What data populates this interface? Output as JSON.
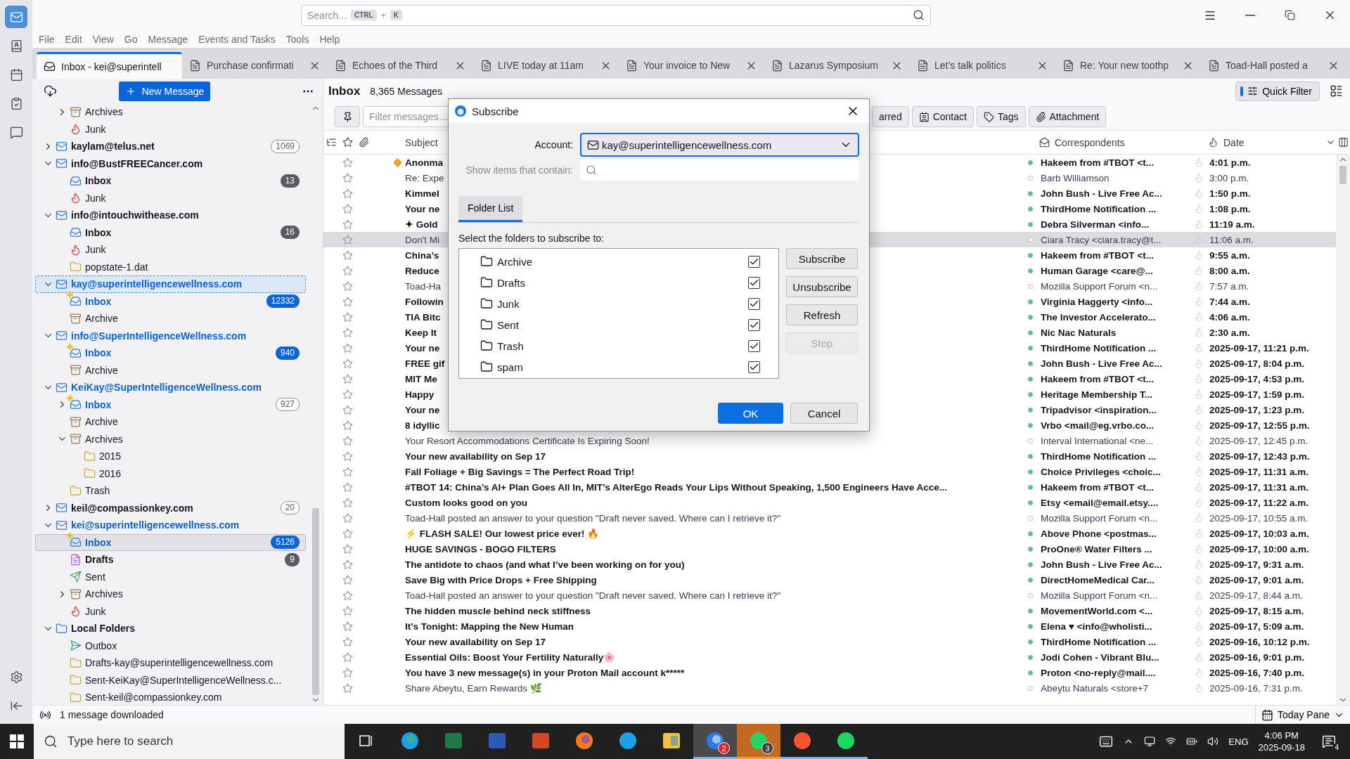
{
  "spaces": [
    {
      "kind": "mail",
      "selected": true
    },
    {
      "kind": "contacts",
      "selected": false
    },
    {
      "kind": "calendar",
      "selected": false
    },
    {
      "kind": "tasks",
      "selected": false
    },
    {
      "kind": "chat",
      "selected": false
    }
  ],
  "search": {
    "placeholder": "Search...",
    "shortcut": [
      "CTRL",
      "+",
      "K"
    ]
  },
  "menu": [
    "File",
    "Edit",
    "View",
    "Go",
    "Message",
    "Events and Tasks",
    "Tools",
    "Help"
  ],
  "tabs": [
    {
      "kind": "folder",
      "label": "Inbox - kei@superintell",
      "selected": true
    },
    {
      "kind": "message",
      "label": "Purchase confirmati",
      "selected": false
    },
    {
      "kind": "message",
      "label": "Echoes of the Third",
      "selected": false
    },
    {
      "kind": "message",
      "label": "LIVE today at 11am",
      "selected": false
    },
    {
      "kind": "message",
      "label": "Your invoice to New",
      "selected": false
    },
    {
      "kind": "message",
      "label": "Lazarus Symposium",
      "selected": false
    },
    {
      "kind": "message",
      "label": "Let’s talk politics",
      "selected": false
    },
    {
      "kind": "message",
      "label": "Re: Your new toothp",
      "selected": false
    },
    {
      "kind": "message",
      "label": "Toad-Hall posted a",
      "selected": false
    }
  ],
  "folder_pane": {
    "new_message": "New Message",
    "tree": [
      {
        "children": [
          {
            "label": "Archives",
            "kind": "archive",
            "expanded": false,
            "unread": false,
            "new": false,
            "selected": false,
            "focused": false
          },
          {
            "label": "Junk",
            "kind": "junk",
            "unread": false,
            "new": false,
            "selected": false,
            "focused": false
          }
        ]
      },
      {
        "label": "kaylam@telus.net",
        "kind": "account",
        "expanded": false,
        "count": "1069",
        "count_outlined": true,
        "unread": true,
        "new": false,
        "selected": false,
        "focused": false
      },
      {
        "label": "info@BustFREECancer.com",
        "kind": "account",
        "expanded": true,
        "unread": true,
        "new": false,
        "selected": false,
        "focused": false,
        "children": [
          {
            "label": "Inbox",
            "kind": "inbox",
            "count": "13",
            "count_outlined": false,
            "unread": true,
            "new": false,
            "selected": false,
            "focused": false
          },
          {
            "label": "Junk",
            "kind": "junk",
            "unread": false,
            "new": false,
            "selected": false,
            "focused": false
          }
        ]
      },
      {
        "label": "info@intouchwithease.com",
        "kind": "account",
        "expanded": true,
        "unread": true,
        "new": false,
        "selected": false,
        "focused": false,
        "children": [
          {
            "label": "Inbox",
            "kind": "inbox",
            "count": "16",
            "count_outlined": false,
            "unread": true,
            "new": false,
            "selected": false,
            "focused": false
          },
          {
            "label": "Junk",
            "kind": "junk",
            "unread": false,
            "new": false,
            "selected": false,
            "focused": false
          },
          {
            "label": "popstate-1.dat",
            "kind": "folder",
            "unread": false,
            "new": false,
            "selected": false,
            "focused": false
          }
        ]
      },
      {
        "label": "kay@superintelligencewellness.com",
        "kind": "account",
        "expanded": true,
        "unread": true,
        "new": true,
        "selected": false,
        "focused": true,
        "children": [
          {
            "label": "Inbox",
            "kind": "inbox",
            "count": "12332",
            "count_outlined": false,
            "unread": true,
            "new": true,
            "selected": false,
            "focused": false
          },
          {
            "label": "Archive",
            "kind": "archive",
            "unread": false,
            "new": false,
            "selected": false,
            "focused": false
          }
        ]
      },
      {
        "label": "info@SuperIntelligenceWellness.com",
        "kind": "account",
        "expanded": true,
        "unread": true,
        "new": true,
        "selected": false,
        "focused": false,
        "children": [
          {
            "label": "Inbox",
            "kind": "inbox",
            "count": "940",
            "count_outlined": false,
            "unread": true,
            "new": true,
            "selected": false,
            "focused": false
          },
          {
            "label": "Archive",
            "kind": "archive",
            "unread": false,
            "new": false,
            "selected": false,
            "focused": false
          }
        ]
      },
      {
        "label": "KeiKay@SuperIntelligenceWellness.com",
        "kind": "account",
        "expanded": true,
        "unread": true,
        "new": true,
        "selected": false,
        "focused": false,
        "children": [
          {
            "label": "Inbox",
            "kind": "inbox",
            "expanded": false,
            "count": "927",
            "count_outlined": true,
            "unread": true,
            "new": true,
            "selected": false,
            "focused": false
          },
          {
            "label": "Archive",
            "kind": "archive",
            "unread": false,
            "new": false,
            "selected": false,
            "focused": false
          },
          {
            "label": "Archives",
            "kind": "archive",
            "expanded": true,
            "unread": false,
            "new": false,
            "selected": false,
            "focused": false,
            "children": [
              {
                "label": "2015",
                "kind": "folder",
                "unread": false,
                "new": false,
                "selected": false,
                "focused": false
              },
              {
                "label": "2016",
                "kind": "folder",
                "unread": false,
                "new": false,
                "selected": false,
                "focused": false
              }
            ]
          },
          {
            "label": "Trash",
            "kind": "folder",
            "unread": false,
            "new": false,
            "selected": false,
            "focused": false
          }
        ]
      },
      {
        "label": "keil@compassionkey.com",
        "kind": "account",
        "expanded": false,
        "count": "20",
        "count_outlined": true,
        "unread": true,
        "new": false,
        "selected": false,
        "focused": false
      },
      {
        "label": "kei@superintelligencewellness.com",
        "kind": "account",
        "expanded": true,
        "unread": true,
        "new": true,
        "selected": false,
        "focused": false,
        "children": [
          {
            "label": "Inbox",
            "kind": "inbox",
            "count": "5126",
            "count_outlined": false,
            "unread": true,
            "new": true,
            "selected": true,
            "focused": false
          },
          {
            "label": "Drafts",
            "kind": "drafts",
            "count": "9",
            "count_outlined": false,
            "unread": true,
            "new": false,
            "selected": false,
            "focused": false
          },
          {
            "label": "Sent",
            "kind": "sent",
            "unread": false,
            "new": false,
            "selected": false,
            "focused": false
          },
          {
            "label": "Archives",
            "kind": "archive",
            "expanded": false,
            "unread": false,
            "new": false,
            "selected": false,
            "focused": false
          },
          {
            "label": "Junk",
            "kind": "junk",
            "unread": false,
            "new": false,
            "selected": false,
            "focused": false
          }
        ]
      },
      {
        "label": "Local Folders",
        "kind": "local",
        "expanded": true,
        "unread": true,
        "new": false,
        "selected": false,
        "focused": false,
        "children": [
          {
            "label": "Outbox",
            "kind": "outbox",
            "unread": false,
            "new": false,
            "selected": false,
            "focused": false
          },
          {
            "label": "Drafts-kay@superintelligencewellness.com",
            "kind": "folder",
            "unread": false,
            "new": false,
            "selected": false,
            "focused": false
          },
          {
            "label": "Sent-KeiKay@SuperIntelligenceWellness.c...",
            "kind": "folder",
            "unread": false,
            "new": false,
            "selected": false,
            "focused": false
          },
          {
            "label": "Sent-keil@compassionkey.com",
            "kind": "folder",
            "unread": false,
            "new": false,
            "selected": false,
            "focused": false
          }
        ]
      }
    ]
  },
  "thread_pane": {
    "folder": "Inbox",
    "count": "8,365 Messages",
    "quick_filter": {
      "label": "Quick Filter",
      "on": true
    },
    "filter": {
      "placeholder": "Filter messages…",
      "buttons": [
        {
          "kind": "starred",
          "label": "arred"
        },
        {
          "kind": "contact",
          "label": "Contact"
        },
        {
          "kind": "tags",
          "label": "Tags"
        },
        {
          "kind": "attachment",
          "label": "Attachment"
        }
      ]
    },
    "columns": {
      "subject": "Subject",
      "correspondents": "Correspondents",
      "date": "Date"
    },
    "rows": [
      {
        "subject": "Anonma",
        "correspondent": "Hakeem from #TBOT <t...",
        "date": "4:01 p.m.",
        "unread": true,
        "new": true,
        "selected": false
      },
      {
        "subject": "Re: Expe",
        "correspondent": "Barb Williamson",
        "date": "3:00 p.m.",
        "unread": false,
        "new": false,
        "selected": false
      },
      {
        "subject": "Kimmel",
        "correspondent": "John Bush - Live Free Ac...",
        "date": "1:50 p.m.",
        "unread": true,
        "new": false,
        "selected": false
      },
      {
        "subject": "Your ne",
        "correspondent": "ThirdHome Notification ...",
        "date": "1:08 p.m.",
        "unread": true,
        "new": false,
        "selected": false
      },
      {
        "subject": "✦ Gold",
        "correspondent": "Debra Silverman <info...",
        "date": "11:19 a.m.",
        "unread": true,
        "new": false,
        "selected": false
      },
      {
        "subject": "Don't Mi",
        "correspondent": "Ciara Tracy <ciara.tracy@t...",
        "date": "11:06 a.m.",
        "unread": false,
        "new": false,
        "selected": true
      },
      {
        "subject": "China’s",
        "correspondent": "Hakeem from #TBOT <t...",
        "date": "9:55 a.m.",
        "unread": true,
        "new": false,
        "selected": false
      },
      {
        "subject": "Reduce",
        "correspondent": "Human Garage <care@...",
        "date": "8:00 a.m.",
        "unread": true,
        "new": false,
        "selected": false
      },
      {
        "subject": "Toad-Ha",
        "correspondent": "Mozilla Support Forum <n...",
        "date": "7:57 a.m.",
        "unread": false,
        "new": false,
        "selected": false
      },
      {
        "subject": "Followin",
        "correspondent": "Virginia Haggerty <info...",
        "date": "7:44 a.m.",
        "unread": true,
        "new": false,
        "selected": false
      },
      {
        "subject": "TIA Bitc",
        "correspondent": "The Investor Accelerato...",
        "date": "4:06 a.m.",
        "unread": true,
        "new": false,
        "selected": false
      },
      {
        "subject": "Keep It",
        "correspondent": "Nic Nac Naturals",
        "date": "2:30 a.m.",
        "unread": true,
        "new": false,
        "selected": false
      },
      {
        "subject": "Your ne",
        "correspondent": "ThirdHome Notification ...",
        "date": "2025-09-17, 11:21 p.m.",
        "unread": true,
        "new": false,
        "selected": false
      },
      {
        "subject": "FREE gif",
        "correspondent": "John Bush - Live Free Ac...",
        "date": "2025-09-17, 8:04 p.m.",
        "unread": true,
        "new": false,
        "selected": false
      },
      {
        "subject": "MIT Me",
        "correspondent": "Hakeem from #TBOT <t...",
        "date": "2025-09-17, 4:53 p.m.",
        "unread": true,
        "new": false,
        "selected": false
      },
      {
        "subject": "Happy",
        "correspondent": "Heritage Membership T...",
        "date": "2025-09-17, 1:59 p.m.",
        "unread": true,
        "new": false,
        "selected": false
      },
      {
        "subject": "Your ne",
        "correspondent": "Tripadvisor <inspiration...",
        "date": "2025-09-17, 1:23 p.m.",
        "unread": true,
        "new": false,
        "selected": false
      },
      {
        "subject": "8 idyllic",
        "correspondent": "Vrbo <mail@eg.vrbo.co...",
        "date": "2025-09-17, 12:55 p.m.",
        "unread": true,
        "new": false,
        "selected": false
      },
      {
        "subject": "Your Resort Accommodations Certificate Is Expiring Soon!",
        "correspondent": "Interval International <ne...",
        "date": "2025-09-17, 12:45 p.m.",
        "unread": false,
        "new": false,
        "selected": false
      },
      {
        "subject": "Your new availability on Sep 17",
        "correspondent": "ThirdHome Notification ...",
        "date": "2025-09-17, 12:43 p.m.",
        "unread": true,
        "new": false,
        "selected": false
      },
      {
        "subject": "Fall Foliage + Big Savings = The Perfect Road Trip!",
        "correspondent": "Choice Privileges <choic...",
        "date": "2025-09-17, 11:31 a.m.",
        "unread": true,
        "new": false,
        "selected": false
      },
      {
        "subject": "#TBOT 14: China’s AI+ Plan Goes All In, MIT’s AlterEgo Reads Your Lips Without Speaking, 1,500 Engineers Have Acce...",
        "correspondent": "Hakeem from #TBOT <t...",
        "date": "2025-09-17, 11:31 a.m.",
        "unread": true,
        "new": false,
        "selected": false
      },
      {
        "subject": "Custom looks good on you",
        "correspondent": "Etsy <email@email.etsy....",
        "date": "2025-09-17, 11:22 a.m.",
        "unread": true,
        "new": false,
        "selected": false
      },
      {
        "subject": "Toad-Hall posted an answer to your question \"Draft never saved. Where can I retrieve it?\"",
        "correspondent": "Mozilla Support Forum <n...",
        "date": "2025-09-17, 10:55 a.m.",
        "unread": false,
        "new": false,
        "selected": false
      },
      {
        "subject": "⚡ FLASH SALE! Our lowest price ever! 🔥",
        "correspondent": "Above Phone <postmas...",
        "date": "2025-09-17, 10:03 a.m.",
        "unread": true,
        "new": false,
        "selected": false
      },
      {
        "subject": "HUGE SAVINGS - BOGO FILTERS",
        "correspondent": "ProOne® Water Filters ...",
        "date": "2025-09-17, 10:00 a.m.",
        "unread": true,
        "new": false,
        "selected": false
      },
      {
        "subject": "The antidote to chaos (and what I’ve been working on for you)",
        "correspondent": "John Bush - Live Free Ac...",
        "date": "2025-09-17, 9:31 a.m.",
        "unread": true,
        "new": false,
        "selected": false
      },
      {
        "subject": "Save Big with Price Drops + Free Shipping",
        "correspondent": "DirectHomeMedical Car...",
        "date": "2025-09-17, 9:01 a.m.",
        "unread": true,
        "new": false,
        "selected": false
      },
      {
        "subject": "Toad-Hall posted an answer to your question \"Draft never saved. Where can I retrieve it?\"",
        "correspondent": "Mozilla Support Forum <n...",
        "date": "2025-09-17, 8:44 a.m.",
        "unread": false,
        "new": false,
        "selected": false
      },
      {
        "subject": "The hidden muscle behind neck stiffness",
        "correspondent": "MovementWorld.com <...",
        "date": "2025-09-17, 8:15 a.m.",
        "unread": true,
        "new": false,
        "selected": false
      },
      {
        "subject": "It’s Tonight: Mapping the New Human",
        "correspondent": "Elena ♥ <info@wholisti...",
        "date": "2025-09-17, 5:09 a.m.",
        "unread": true,
        "new": false,
        "selected": false
      },
      {
        "subject": "Your new availability on Sep 17",
        "correspondent": "ThirdHome Notification ...",
        "date": "2025-09-16, 10:12 p.m.",
        "unread": true,
        "new": false,
        "selected": false
      },
      {
        "subject": "Essential Oils: Boost Your Fertility Naturally🌸",
        "correspondent": "Jodi Cohen - Vibrant Blu...",
        "date": "2025-09-16, 9:01 p.m.",
        "unread": true,
        "new": false,
        "selected": false
      },
      {
        "subject": "You have 3 new message(s) in your Proton Mail account k*****",
        "correspondent": "Proton <no-reply@mail....",
        "date": "2025-09-16, 7:40 p.m.",
        "unread": true,
        "new": false,
        "selected": false
      },
      {
        "subject": "Share Abeytu, Earn Rewards 🌿",
        "correspondent": "Abeytu Naturals <store+7",
        "date": "2025-09-16, 7:31 p.m.",
        "unread": false,
        "new": false,
        "selected": false
      }
    ]
  },
  "dialog": {
    "title": "Subscribe",
    "account_label": "Account:",
    "account": "kay@superintelligencewellness.com",
    "filter_label": "Show items that contain:",
    "tabs": [
      {
        "label": "Folder List",
        "selected": true
      }
    ],
    "list_label": "Select the folders to subscribe to:",
    "folders": [
      {
        "label": "Archive",
        "checked": true
      },
      {
        "label": "Drafts",
        "checked": true
      },
      {
        "label": "Junk",
        "checked": true
      },
      {
        "label": "Sent",
        "checked": true
      },
      {
        "label": "Trash",
        "checked": true
      },
      {
        "label": "spam",
        "checked": true
      }
    ],
    "actions": [
      {
        "label": "Subscribe",
        "disabled": false
      },
      {
        "label": "Unsubscribe",
        "disabled": false
      },
      {
        "label": "Refresh",
        "disabled": false
      },
      {
        "label": "Stop",
        "disabled": true
      }
    ],
    "buttons": [
      {
        "label": "OK",
        "kind": "primary"
      },
      {
        "label": "Cancel",
        "kind": "secondary"
      }
    ]
  },
  "status_bar": {
    "text": "1 message downloaded",
    "today_pane": "Today Pane"
  },
  "taskbar": {
    "search_placeholder": "Type here to search",
    "apps": [
      {
        "kind": "taskview",
        "running": false,
        "active": false,
        "flashing": false
      },
      {
        "kind": "edge",
        "running": false,
        "active": false,
        "flashing": false
      },
      {
        "kind": "excel",
        "running": false,
        "active": false,
        "flashing": false
      },
      {
        "kind": "word",
        "running": false,
        "active": false,
        "flashing": false
      },
      {
        "kind": "powerpoint",
        "running": false,
        "active": false,
        "flashing": false
      },
      {
        "kind": "firefox",
        "running": false,
        "active": false,
        "flashing": false
      },
      {
        "kind": "skype",
        "running": false,
        "active": false,
        "flashing": false
      },
      {
        "kind": "explorer",
        "running": false,
        "active": false,
        "flashing": false
      },
      {
        "kind": "thunderbird",
        "running": true,
        "active": true,
        "flashing": false,
        "badge": "2"
      },
      {
        "kind": "whatsapp",
        "running": true,
        "active": false,
        "flashing": true,
        "badge": "3"
      },
      {
        "kind": "brave",
        "running": true,
        "active": false,
        "flashing": false
      },
      {
        "kind": "spotify",
        "running": true,
        "active": false,
        "flashing": false
      }
    ],
    "language": "ENG",
    "time": "4:06 PM",
    "date": "2025-09-18",
    "notifications": "4"
  }
}
